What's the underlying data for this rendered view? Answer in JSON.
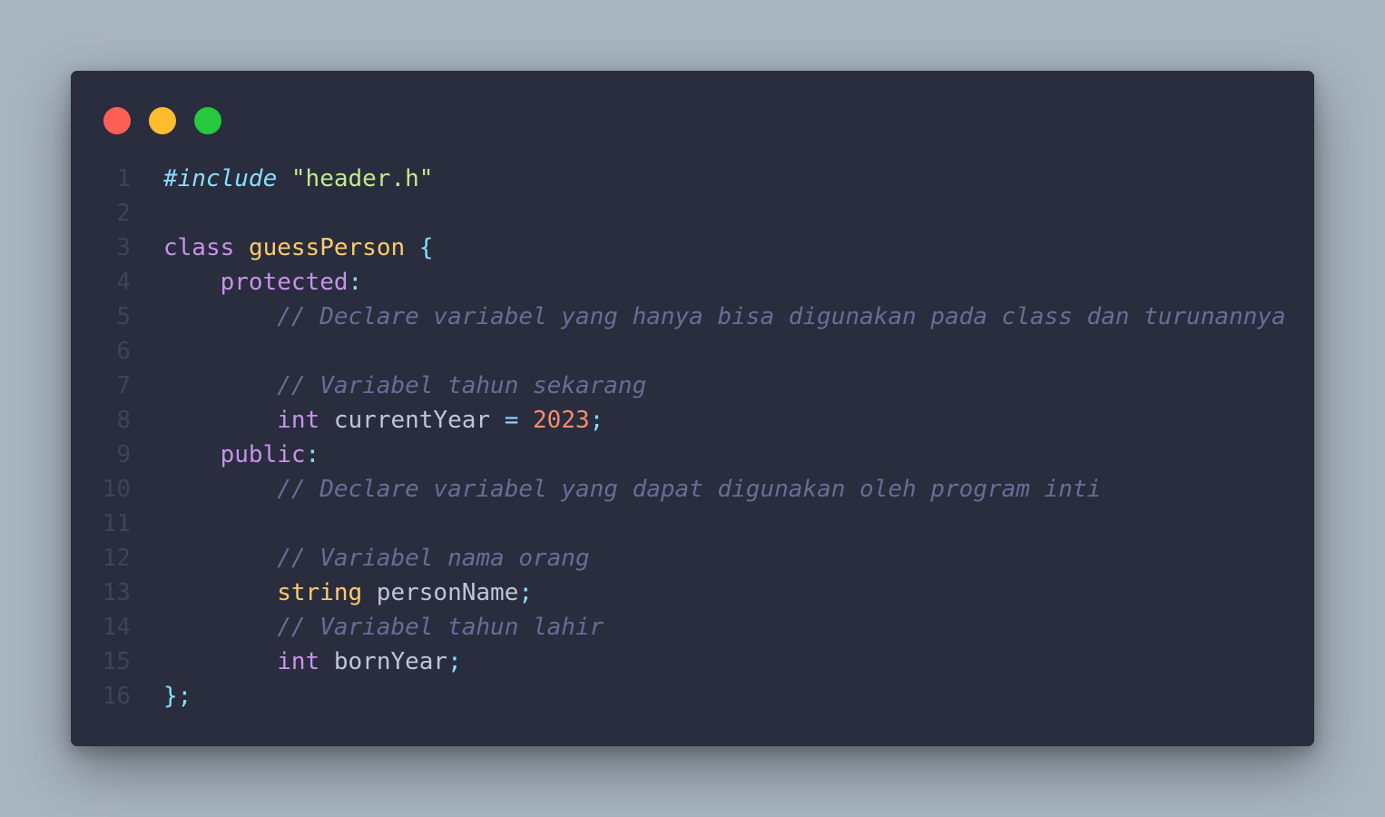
{
  "window": {
    "buttons": [
      {
        "name": "close",
        "color": "#ff5f56"
      },
      {
        "name": "minimize",
        "color": "#ffbd2e"
      },
      {
        "name": "maximize",
        "color": "#27c93f"
      }
    ]
  },
  "code": {
    "language": "cpp",
    "lines": [
      {
        "number": "1",
        "indent": "",
        "tokens": [
          {
            "text": "#include",
            "kind": "include"
          },
          {
            "text": " ",
            "kind": "plain"
          },
          {
            "text": "\"header.h\"",
            "kind": "string"
          }
        ]
      },
      {
        "number": "2",
        "indent": "",
        "tokens": []
      },
      {
        "number": "3",
        "indent": "",
        "tokens": [
          {
            "text": "class",
            "kind": "keyword"
          },
          {
            "text": " ",
            "kind": "plain"
          },
          {
            "text": "guessPerson",
            "kind": "class-name"
          },
          {
            "text": " ",
            "kind": "plain"
          },
          {
            "text": "{",
            "kind": "punct"
          }
        ]
      },
      {
        "number": "4",
        "indent": "    ",
        "tokens": [
          {
            "text": "protected",
            "kind": "keyword"
          },
          {
            "text": ":",
            "kind": "punct"
          }
        ]
      },
      {
        "number": "5",
        "indent": "        ",
        "tokens": [
          {
            "text": "// Declare variabel yang hanya bisa digunakan pada class dan turunannya",
            "kind": "comment"
          }
        ]
      },
      {
        "number": "6",
        "indent": "",
        "tokens": []
      },
      {
        "number": "7",
        "indent": "        ",
        "tokens": [
          {
            "text": "// Variabel tahun sekarang",
            "kind": "comment"
          }
        ]
      },
      {
        "number": "8",
        "indent": "        ",
        "tokens": [
          {
            "text": "int",
            "kind": "keyword"
          },
          {
            "text": " currentYear ",
            "kind": "plain"
          },
          {
            "text": "=",
            "kind": "op"
          },
          {
            "text": " ",
            "kind": "plain"
          },
          {
            "text": "2023",
            "kind": "number"
          },
          {
            "text": ";",
            "kind": "punct"
          }
        ]
      },
      {
        "number": "9",
        "indent": "    ",
        "tokens": [
          {
            "text": "public",
            "kind": "keyword"
          },
          {
            "text": ":",
            "kind": "punct"
          }
        ]
      },
      {
        "number": "10",
        "indent": "        ",
        "tokens": [
          {
            "text": "// Declare variabel yang dapat digunakan oleh program inti",
            "kind": "comment"
          }
        ]
      },
      {
        "number": "11",
        "indent": "",
        "tokens": []
      },
      {
        "number": "12",
        "indent": "        ",
        "tokens": [
          {
            "text": "// Variabel nama orang",
            "kind": "comment"
          }
        ]
      },
      {
        "number": "13",
        "indent": "        ",
        "tokens": [
          {
            "text": "string",
            "kind": "type"
          },
          {
            "text": " personName",
            "kind": "plain"
          },
          {
            "text": ";",
            "kind": "punct"
          }
        ]
      },
      {
        "number": "14",
        "indent": "        ",
        "tokens": [
          {
            "text": "// Variabel tahun lahir",
            "kind": "comment"
          }
        ]
      },
      {
        "number": "15",
        "indent": "        ",
        "tokens": [
          {
            "text": "int",
            "kind": "keyword"
          },
          {
            "text": " bornYear",
            "kind": "plain"
          },
          {
            "text": ";",
            "kind": "punct"
          }
        ]
      },
      {
        "number": "16",
        "indent": "",
        "tokens": [
          {
            "text": "};",
            "kind": "punct"
          }
        ]
      }
    ]
  }
}
